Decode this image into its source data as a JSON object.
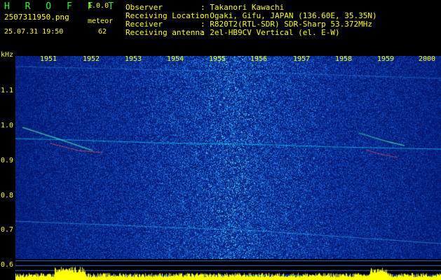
{
  "header": {
    "title": "H R O F F T",
    "version": "1.0.0",
    "filename": "2507311950.png",
    "datetime": "25.07.31 19:50",
    "meteor_label": "meteor",
    "meteor_count": "62"
  },
  "info": [
    {
      "key": "Observer",
      "value": ": Takanori Kawachi"
    },
    {
      "key": "Receiving Location",
      "value": ": Ogaki, Gifu, JAPAN (136.60E, 35.35N)"
    },
    {
      "key": "Receiver",
      "value": ": R820T2(RTL-SDR) SDR-Sharp 53.372MHz"
    },
    {
      "key": "Receiving antenna",
      "value": ": 2el-HB9CV Vertical (el. E-W)"
    }
  ],
  "axis": {
    "y_unit": "kHz",
    "y_ticks": [
      "1.1",
      "1.0",
      "0.9",
      "0.8",
      "0.7",
      "0.6"
    ],
    "x_ticks": [
      "1951",
      "1952",
      "1953",
      "1954",
      "1955",
      "1956",
      "1957",
      "1958",
      "1959",
      "2000"
    ]
  },
  "colors": {
    "text": "#ffff00",
    "title": "#22ff22",
    "background": "#000000",
    "noise_base": "#0a2a8a",
    "signal": "#00ffff",
    "echo": "#ff4040"
  }
}
